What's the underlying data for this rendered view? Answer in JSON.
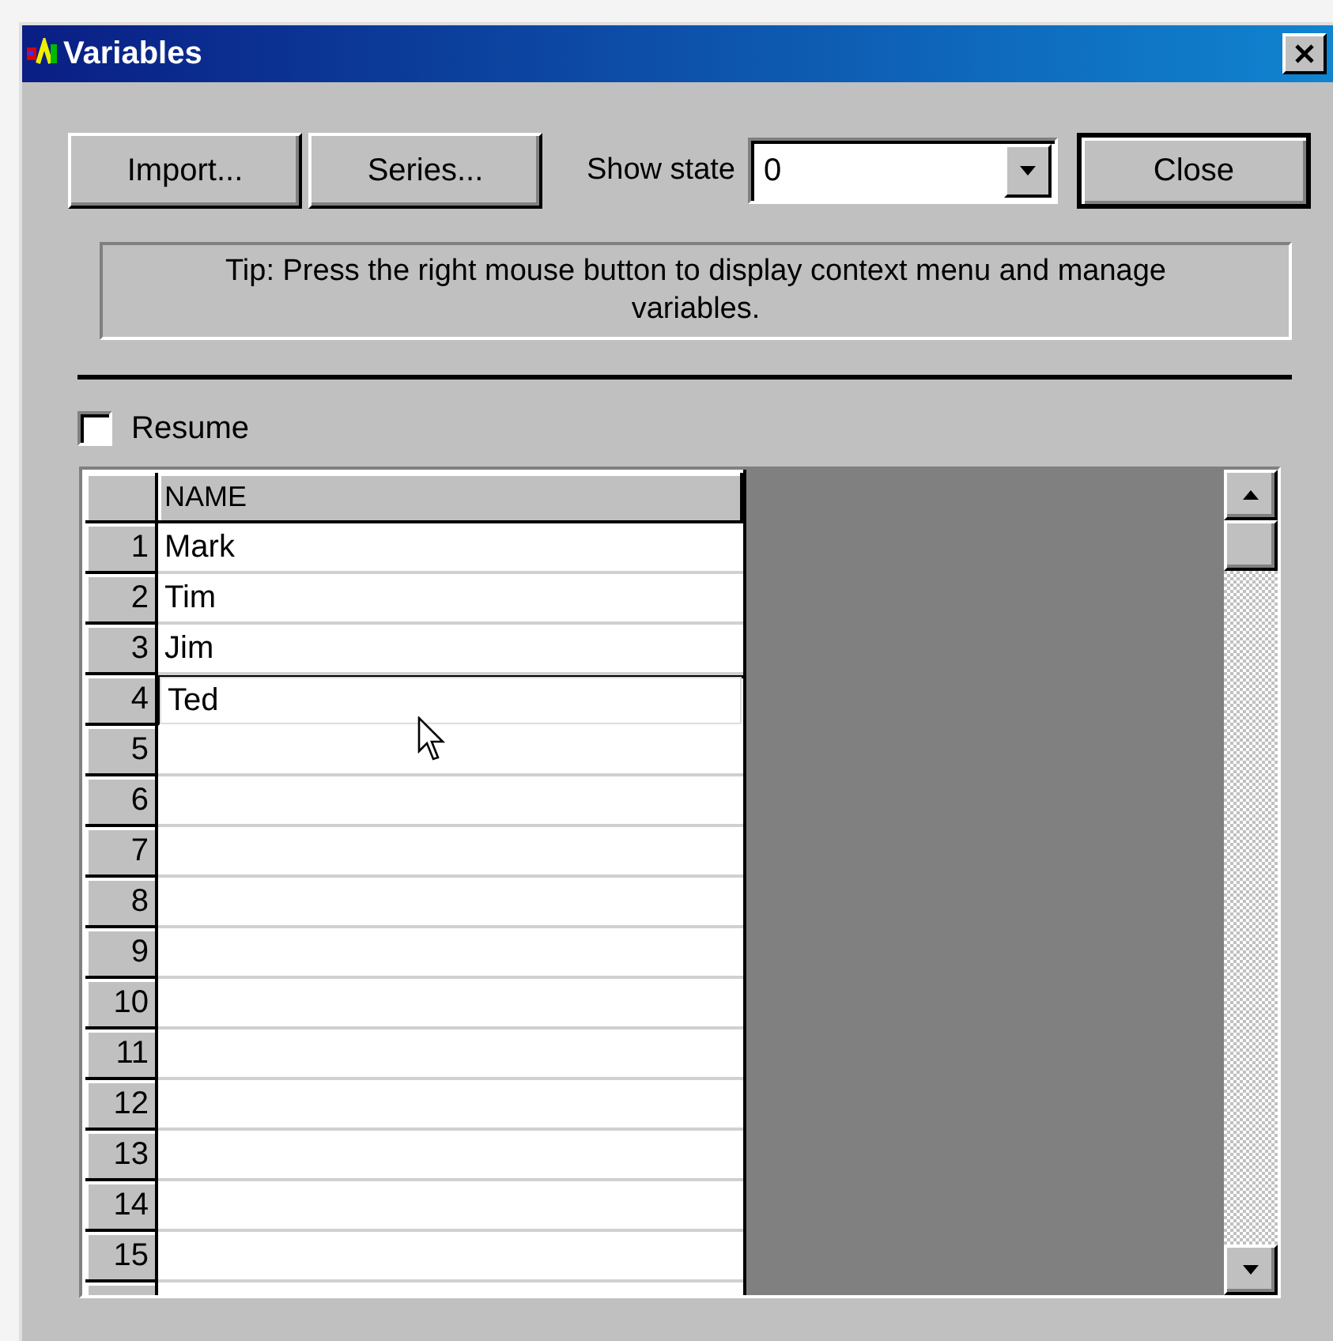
{
  "window": {
    "title": "Variables"
  },
  "toolbar": {
    "buttons": [
      {
        "label": "Import..."
      },
      {
        "label": "Series..."
      }
    ],
    "show_state": {
      "label": "Show state",
      "value": "0"
    },
    "close_button": {
      "label": "Close"
    }
  },
  "tip": "Tip:  Press the right mouse button to display context menu and manage variables.",
  "resume": {
    "label": "Resume",
    "checked": false
  },
  "grid": {
    "columns": [
      "NAME"
    ],
    "rows": [
      {
        "number": "1",
        "name": "Mark",
        "selected": false
      },
      {
        "number": "2",
        "name": "Tim",
        "selected": false
      },
      {
        "number": "3",
        "name": "Jim",
        "selected": false
      },
      {
        "number": "4",
        "name": "Ted",
        "selected": true
      },
      {
        "number": "5",
        "selected": false
      },
      {
        "number": "6",
        "selected": false
      },
      {
        "number": "7",
        "selected": false
      },
      {
        "number": "8",
        "selected": false
      },
      {
        "number": "9",
        "selected": false
      },
      {
        "number": "10",
        "selected": false
      },
      {
        "number": "11",
        "selected": false
      },
      {
        "number": "12",
        "selected": false
      },
      {
        "number": "13",
        "selected": false
      },
      {
        "number": "14",
        "selected": false
      },
      {
        "number": "15",
        "selected": false
      }
    ]
  }
}
